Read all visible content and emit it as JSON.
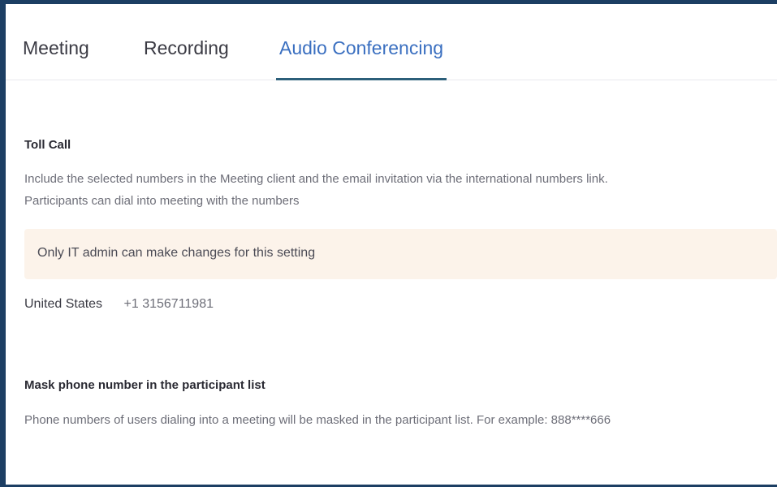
{
  "tabs": [
    {
      "label": "Meeting",
      "active": false
    },
    {
      "label": "Recording",
      "active": false
    },
    {
      "label": "Audio Conferencing",
      "active": true
    }
  ],
  "toll_call": {
    "title": "Toll Call",
    "description_line1": "Include the selected numbers in the Meeting client and the email invitation via the international numbers link.",
    "description_line2": "Participants can dial into meeting with the numbers",
    "notice": "Only IT admin can make changes for this setting",
    "close_glyph": "×",
    "country": "United States",
    "number": "+1 3156711981"
  },
  "mask_phone": {
    "title": "Mask phone number in the participant list",
    "description": "Phone numbers of users dialing into a meeting will be masked in the participant list. For example: 888****666"
  },
  "colors": {
    "frame": "#1c3e63",
    "active_tab": "#3a6fc0",
    "tab_underline": "#2c5f7a",
    "notice_bg": "#fcf3ea"
  }
}
